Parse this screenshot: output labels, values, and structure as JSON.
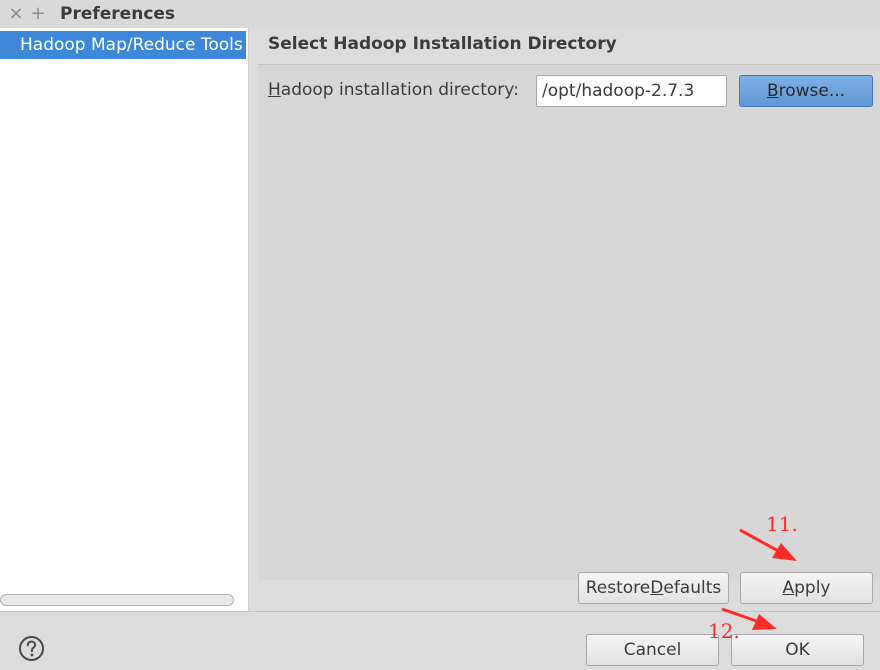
{
  "window": {
    "title": "Preferences",
    "close_glyph": "×",
    "maximize_glyph": "+"
  },
  "sidebar": {
    "items": [
      {
        "label": "Hadoop Map/Reduce Tools",
        "selected": true
      }
    ]
  },
  "main": {
    "page_title": "Select Hadoop Installation Directory",
    "field_label": "Hadoop installation directory:",
    "field_value": "/opt/hadoop-2.7.3",
    "browse_label": "Browse..."
  },
  "buttons": {
    "restore_defaults": "Restore Defaults",
    "apply": "Apply",
    "cancel": "Cancel",
    "ok": "OK"
  },
  "annotations": {
    "step_11": "11.",
    "step_12": "12.",
    "color": "#ff2a2a"
  },
  "icons": {
    "help": "question-circle-icon"
  },
  "colors": {
    "selection": "#3d88d8",
    "browse_button": "#6ea3df",
    "window_bg": "#dcdcdc"
  }
}
